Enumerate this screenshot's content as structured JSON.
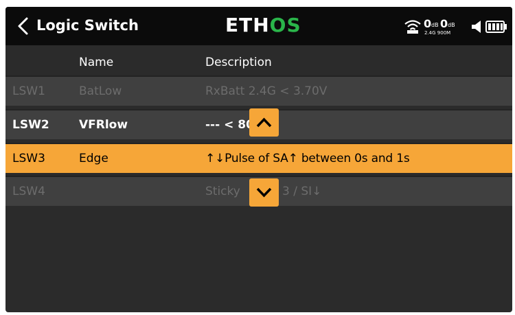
{
  "header": {
    "title": "Logic Switch",
    "logo_main": "ETH",
    "logo_accent": "OS",
    "logo_accent_color": "#2ab54a",
    "signal1_value": "0",
    "signal1_unit": "dB",
    "signal2_value": "0",
    "signal2_unit": "dB",
    "bands": "2.4G 900M",
    "icons": [
      "back-icon",
      "signal-icon",
      "speaker-icon",
      "battery-icon"
    ]
  },
  "columns": {
    "name": "Name",
    "description": "Description"
  },
  "rows": [
    {
      "id": "LSW1",
      "name": "BatLow",
      "description": "RxBatt 2.4G < 3.70V",
      "state": "inactive"
    },
    {
      "id": "LSW2",
      "name": "VFRlow",
      "description": "--- < 80",
      "state": "active"
    },
    {
      "id": "LSW3",
      "name": "Edge",
      "description": "↑↓Pulse of SA↑ between 0s and 1s",
      "state": "selected"
    },
    {
      "id": "LSW4",
      "name": "",
      "description": "Sticky",
      "description_tail": "3 / SI↓",
      "state": "inactive"
    }
  ],
  "colors": {
    "accent": "#f6a638",
    "background": "#2b2b2b",
    "header": "#0b0b0b",
    "row": "#404040",
    "dim_text": "#6c6c6c"
  },
  "scroll": {
    "up_icon": "chevron-up-icon",
    "down_icon": "chevron-down-icon"
  }
}
